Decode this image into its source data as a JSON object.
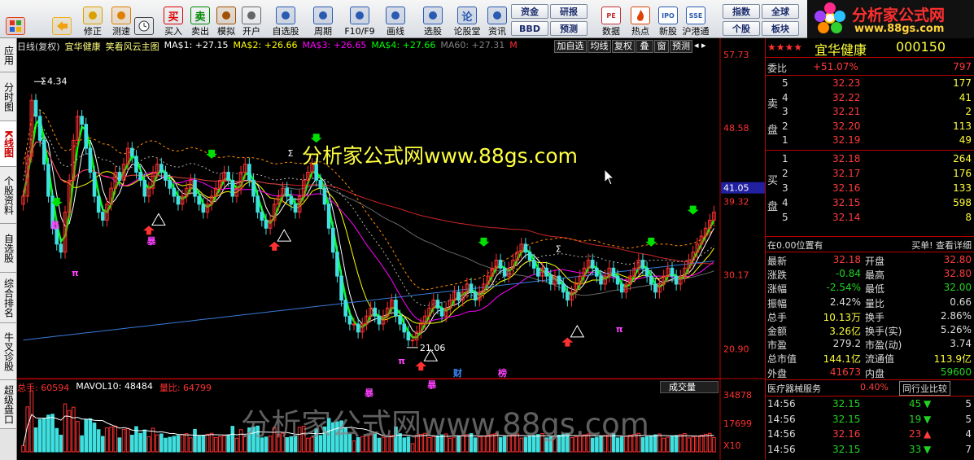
{
  "toolbar": {
    "buttons": [
      {
        "label": "",
        "icon": "windows-grid-icon",
        "color": "#e0401f"
      },
      {
        "label": "",
        "icon": "back-arrow-icon",
        "color": "#f0b020"
      },
      {
        "label": "修正",
        "icon": "up-down-arrow-icon",
        "color": "#d9a000"
      },
      {
        "label": "测速",
        "icon": "refresh-icon",
        "color": "#e07f00"
      },
      {
        "label": "",
        "icon": "clock-icon",
        "color": "#444"
      },
      {
        "label": "买入",
        "icon": "买",
        "color": "#d00"
      },
      {
        "label": "卖出",
        "icon": "卖",
        "color": "#080"
      },
      {
        "label": "模拟",
        "icon": "hammer-icon",
        "color": "#a05000"
      },
      {
        "label": "开户",
        "icon": "lock-icon",
        "color": "#666"
      },
      {
        "label": "自选股",
        "icon": "star-folder-icon",
        "color": "#2a5bb0"
      },
      {
        "label": "周期",
        "icon": "cycle-icon",
        "color": "#2a5bb0"
      },
      {
        "label": "F10/F9",
        "icon": "doc-icon",
        "color": "#2a5bb0"
      },
      {
        "label": "画线",
        "icon": "pen-icon",
        "color": "#2a5bb0"
      },
      {
        "label": "选股",
        "icon": "screen-icon",
        "color": "#2a5bb0"
      },
      {
        "label": "论股堂",
        "icon": "论",
        "color": "#2a5bb0"
      },
      {
        "label": "资讯",
        "icon": "news-icon",
        "color": "#2a5bb0"
      }
    ],
    "small_buttons": [
      {
        "label": "资金"
      },
      {
        "label": "研报"
      },
      {
        "label": "BBD"
      },
      {
        "label": "预测"
      }
    ],
    "buttons2": [
      {
        "label": "数据",
        "icon": "PE",
        "color": "#c03030"
      },
      {
        "label": "热点",
        "icon": "fire-icon",
        "color": "#e04000"
      },
      {
        "label": "新股",
        "icon": "IPO",
        "color": "#2a5bb0"
      },
      {
        "label": "沪港通",
        "icon": "SSE",
        "color": "#2a5bb0"
      }
    ],
    "small_buttons2": [
      {
        "label": "指数"
      },
      {
        "label": "全球"
      },
      {
        "label": "个股"
      },
      {
        "label": "板块"
      }
    ]
  },
  "logo": {
    "title": "分析家公式网",
    "url": "www.88gs.com"
  },
  "leftnav": [
    {
      "label": "应用"
    },
    {
      "label": "分时图"
    },
    {
      "label": "K线图",
      "active": true
    },
    {
      "label": "个股资料"
    },
    {
      "label": "自选股"
    },
    {
      "label": "综合排名"
    },
    {
      "label": "牛叉诊股"
    },
    {
      "label": "超级盘口"
    }
  ],
  "chart": {
    "period": "日线(复权)",
    "stock_name": "宜华健康",
    "formula": "笑看风云主图",
    "ma": [
      {
        "label": "MA$1: +27.15",
        "color": "#ffffff"
      },
      {
        "label": "MA$2: +26.66",
        "color": "#ffff00"
      },
      {
        "label": "MA$3: +26.65",
        "color": "#ff00ff"
      },
      {
        "label": "MA$4: +27.66",
        "color": "#00ff00"
      },
      {
        "label": "MA60: +27.31",
        "color": "#808080"
      },
      {
        "label": "M",
        "color": "#ff3030"
      }
    ],
    "tabs": [
      {
        "label": "加自选"
      },
      {
        "label": "均线"
      },
      {
        "label": "复权"
      },
      {
        "label": "叠"
      },
      {
        "label": "窗"
      },
      {
        "label": "预测"
      }
    ],
    "price_axis": [
      {
        "value": "57.73"
      },
      {
        "value": "48.58"
      },
      {
        "value": "41.05",
        "highlight": true
      },
      {
        "value": "39.32"
      },
      {
        "value": "30.17"
      },
      {
        "value": "20.90"
      }
    ],
    "high_label": "4.34",
    "low_label": "21.06",
    "watermark": "分析家公式网www.88gs.com",
    "events": [
      {
        "label": "财"
      },
      {
        "label": "榜"
      }
    ],
    "sigma_labels": [
      "Σ",
      "Σ",
      "Σ"
    ],
    "triangle_labels": [
      "暴",
      "暴",
      "暴",
      "暴",
      "π",
      "π",
      "π"
    ],
    "volume": {
      "header": [
        {
          "label": "总手: 60594",
          "color": "#ff3030"
        },
        {
          "label": "MAVOL10: 48484",
          "color": "#ffffff"
        },
        {
          "label": "量比: 64799",
          "color": "#ff3030"
        }
      ],
      "dropdown": "成交量",
      "axis": [
        {
          "value": "34878"
        },
        {
          "value": "17699"
        },
        {
          "value": "X10"
        }
      ],
      "watermark": "分析家公式网www.88gs.com"
    }
  },
  "chart_data": {
    "type": "candlestick",
    "price_axis_ticks": [
      57.73,
      48.58,
      39.32,
      30.17,
      20.9
    ],
    "current_price_marker": 41.05,
    "high": 54.34,
    "low": 21.06,
    "closes": [
      40,
      45,
      52,
      50,
      47,
      44,
      40,
      36,
      34,
      33,
      38,
      42,
      47,
      50,
      49,
      46,
      43,
      40,
      38,
      37,
      39,
      41,
      43,
      42,
      44,
      46,
      45,
      43,
      42,
      40,
      41,
      43,
      44,
      43,
      42,
      41,
      40,
      39,
      40,
      41,
      42,
      40,
      39,
      38,
      39,
      40,
      41,
      42,
      43,
      42,
      40,
      41,
      43,
      44,
      42,
      40,
      38,
      37,
      36,
      37,
      39,
      40,
      41,
      40,
      39,
      38,
      40,
      42,
      43,
      44,
      42,
      41,
      39,
      36,
      33,
      30,
      27,
      25,
      24,
      24,
      23,
      24,
      25,
      26,
      25,
      24,
      25,
      26,
      27,
      25,
      24,
      23,
      22,
      22,
      23,
      24,
      25,
      26,
      27,
      26,
      25,
      26,
      27,
      28,
      27,
      28,
      29,
      28,
      27,
      28,
      29,
      30,
      31,
      32,
      31,
      30,
      31,
      32,
      33,
      34,
      33,
      32,
      31,
      30,
      31,
      30,
      29,
      30,
      29,
      28,
      27,
      28,
      29,
      30,
      31,
      32,
      31,
      30,
      29,
      30,
      31,
      30,
      29,
      28,
      29,
      30,
      31,
      32,
      31,
      30,
      29,
      28,
      29,
      30,
      31,
      30,
      29,
      30,
      31,
      32,
      33,
      34,
      35,
      36,
      37,
      38
    ]
  },
  "quote": {
    "name": "宜华健康",
    "code": "000150",
    "weibi_label": "委比",
    "weibi": "+51.07%",
    "weicha": "797",
    "sell_label": "卖盘",
    "buy_label": "买盘",
    "sell": [
      {
        "lvl": "5",
        "price": "32.23",
        "vol": "177"
      },
      {
        "lvl": "4",
        "price": "32.22",
        "vol": "41"
      },
      {
        "lvl": "3",
        "price": "32.21",
        "vol": "2"
      },
      {
        "lvl": "2",
        "price": "32.20",
        "vol": "113"
      },
      {
        "lvl": "1",
        "price": "32.19",
        "vol": "49"
      }
    ],
    "buy": [
      {
        "lvl": "1",
        "price": "32.18",
        "vol": "264"
      },
      {
        "lvl": "2",
        "price": "32.17",
        "vol": "176"
      },
      {
        "lvl": "3",
        "price": "32.16",
        "vol": "133"
      },
      {
        "lvl": "4",
        "price": "32.15",
        "vol": "598"
      },
      {
        "lvl": "5",
        "price": "32.14",
        "vol": "8"
      }
    ],
    "position_label": "在0.00位置有",
    "buy_notice": "买单! 查看详细",
    "stats": [
      [
        {
          "k": "最新",
          "v": "32.18",
          "vc": "red"
        },
        {
          "k": "开盘",
          "v": "32.80",
          "vc": "red"
        }
      ],
      [
        {
          "k": "涨跌",
          "v": "-0.84",
          "vc": "green"
        },
        {
          "k": "最高",
          "v": "32.80",
          "vc": "red"
        }
      ],
      [
        {
          "k": "涨幅",
          "v": "-2.54%",
          "vc": "green"
        },
        {
          "k": "最低",
          "v": "32.00",
          "vc": "green"
        }
      ],
      [
        {
          "k": "振幅",
          "v": "2.42%",
          "vc": "white"
        },
        {
          "k": "量比",
          "v": "0.66",
          "vc": "white"
        }
      ],
      [
        {
          "k": "总手",
          "v": "10.13万",
          "vc": "yellow"
        },
        {
          "k": "换手",
          "v": "2.86%",
          "vc": "white"
        }
      ],
      [
        {
          "k": "金额",
          "v": "3.26亿",
          "vc": "yellow"
        },
        {
          "k": "换手(实)",
          "v": "5.26%",
          "vc": "white"
        }
      ],
      [
        {
          "k": "市盈",
          "v": "279.2",
          "vc": "white"
        },
        {
          "k": "市盈(动)",
          "v": "3.74",
          "vc": "white"
        }
      ],
      [
        {
          "k": "总市值",
          "v": "144.1亿",
          "vc": "yellow"
        },
        {
          "k": "流通值",
          "v": "113.9亿",
          "vc": "yellow"
        }
      ],
      [
        {
          "k": "外盘",
          "v": "41673",
          "vc": "red"
        },
        {
          "k": "内盘",
          "v": "59600",
          "vc": "green"
        }
      ]
    ],
    "sector": {
      "name": "医疗器械服务",
      "pct": "0.40%",
      "compare": "同行业比较"
    },
    "ticks": [
      {
        "time": "14:56",
        "price": "32.15",
        "vol": "45",
        "dir": "down",
        "n": "5"
      },
      {
        "time": "14:56",
        "price": "32.15",
        "vol": "19",
        "dir": "down",
        "n": "5"
      },
      {
        "time": "14:56",
        "price": "32.16",
        "vol": "23",
        "dir": "up",
        "n": "4"
      },
      {
        "time": "14:56",
        "price": "32.15",
        "vol": "33",
        "dir": "down",
        "n": "7"
      }
    ]
  }
}
